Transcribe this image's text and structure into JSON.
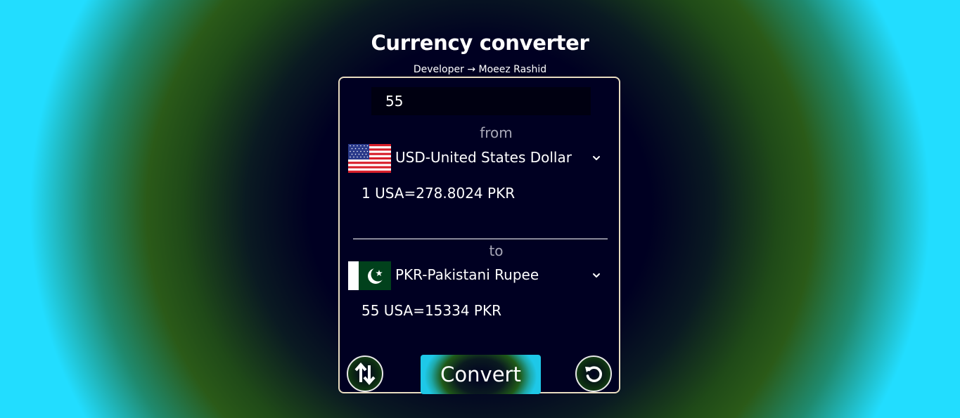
{
  "header": {
    "title": "Currency converter",
    "subtitle": "Developer → Moeez Rashid"
  },
  "converter": {
    "amount": "55",
    "from": {
      "label": "from",
      "currency": "USD-United States Dollar",
      "flag_icon": "us-flag-icon",
      "rate_text": "1 USA=278.8024 PKR"
    },
    "to": {
      "label": "to",
      "currency": "PKR-Pakistani Rupee",
      "flag_icon": "pk-flag-icon",
      "result_text": "55 USA=15334 PKR"
    },
    "buttons": {
      "swap_icon": "swap-arrows-icon",
      "convert_label": "Convert",
      "reset_icon": "reset-icon"
    }
  },
  "colors": {
    "edge_cyan": "#22ddff",
    "dark_navy": "#000022",
    "green_band": "#2a5a18",
    "card_border": "#e8dcc0",
    "label_gray": "#a8a8b8"
  }
}
